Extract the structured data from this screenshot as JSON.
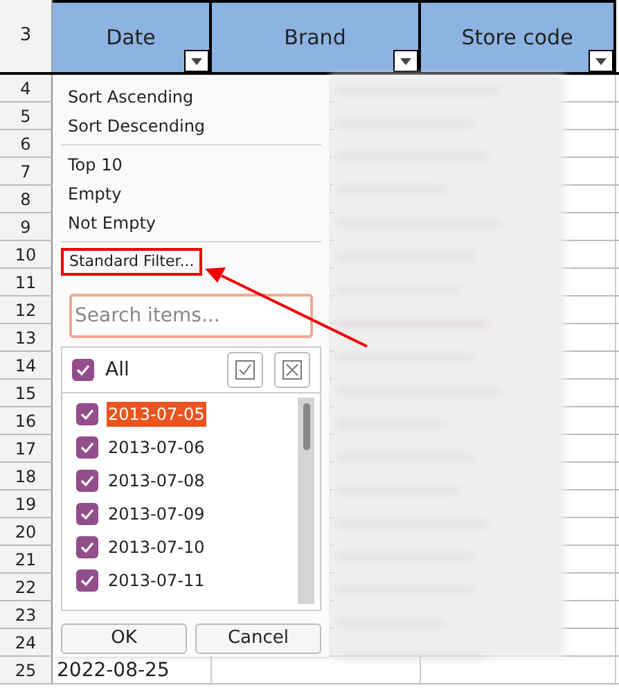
{
  "sheet": {
    "corner_row": "3",
    "columns": [
      {
        "label": "Date"
      },
      {
        "label": "Brand"
      },
      {
        "label": "Store code"
      }
    ],
    "rows": [
      {
        "number": "4"
      },
      {
        "number": "5"
      },
      {
        "number": "6"
      },
      {
        "number": "7"
      },
      {
        "number": "8"
      },
      {
        "number": "9"
      },
      {
        "number": "10"
      },
      {
        "number": "11"
      },
      {
        "number": "12"
      },
      {
        "number": "13"
      },
      {
        "number": "14"
      },
      {
        "number": "15"
      },
      {
        "number": "16"
      },
      {
        "number": "17"
      },
      {
        "number": "18"
      },
      {
        "number": "19"
      },
      {
        "number": "20"
      },
      {
        "number": "21"
      },
      {
        "number": "22"
      },
      {
        "number": "23"
      },
      {
        "number": "24"
      },
      {
        "number": "25",
        "date": "2022-08-25"
      }
    ]
  },
  "filter_popup": {
    "menu_groups": [
      [
        "Sort Ascending",
        "Sort Descending"
      ],
      [
        "Top 10",
        "Empty",
        "Not Empty"
      ]
    ],
    "standard_filter": "Standard Filter...",
    "search": {
      "placeholder": "Search items..."
    },
    "all": {
      "label": "All",
      "checked": true
    },
    "items": [
      {
        "label": "2013-07-05",
        "checked": true,
        "selected": true
      },
      {
        "label": "2013-07-06",
        "checked": true,
        "selected": false
      },
      {
        "label": "2013-07-08",
        "checked": true,
        "selected": false
      },
      {
        "label": "2013-07-09",
        "checked": true,
        "selected": false
      },
      {
        "label": "2013-07-10",
        "checked": true,
        "selected": false
      },
      {
        "label": "2013-07-11",
        "checked": true,
        "selected": false
      }
    ],
    "buttons": [
      "OK",
      "Cancel"
    ]
  }
}
